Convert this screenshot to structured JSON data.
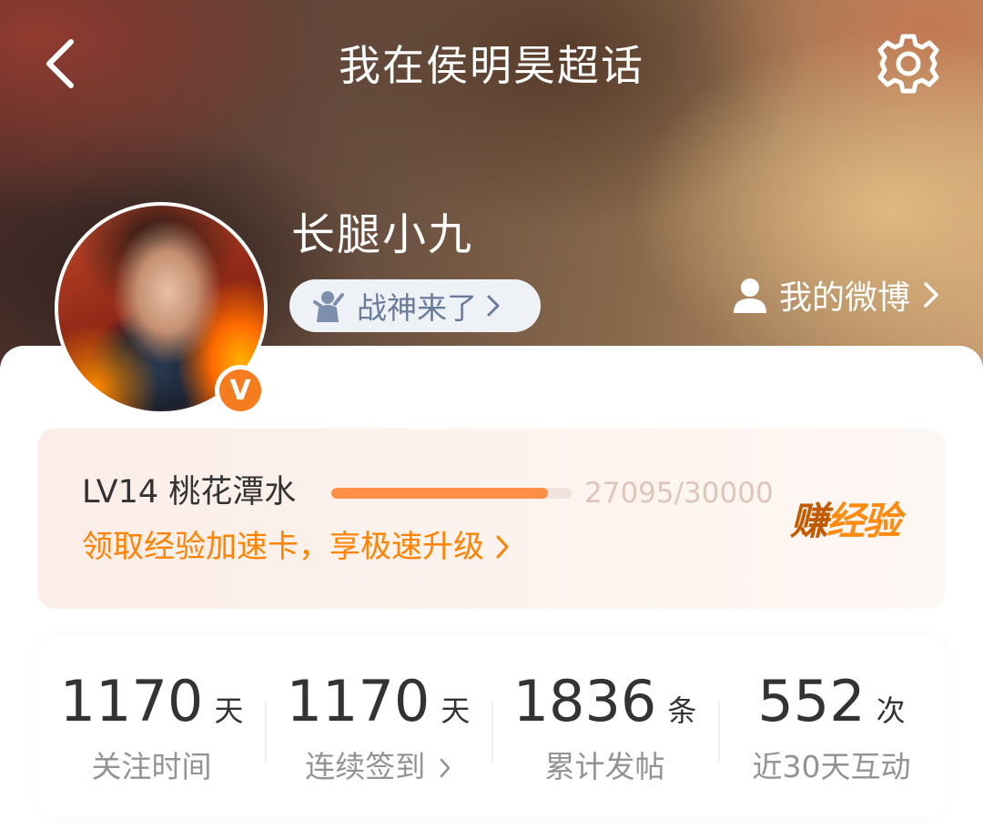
{
  "header": {
    "title": "我在侯明昊超话"
  },
  "profile": {
    "username": "长腿小九",
    "badge_label": "战神来了",
    "my_weibo_label": "我的微博",
    "verified_mark": "V"
  },
  "level": {
    "name": "LV14 桃花潭水",
    "progress_text": "27095/30000",
    "progress_fraction": 0.903,
    "promo_text": "领取经验加速卡，享极速升级",
    "earn_part1": "赚",
    "earn_part2": "经验"
  },
  "stats": [
    {
      "value": "1170",
      "unit": "天",
      "label": "关注时间"
    },
    {
      "value": "1170",
      "unit": "天",
      "label": "连续签到"
    },
    {
      "value": "1836",
      "unit": "条",
      "label": "累计发帖"
    },
    {
      "value": "552",
      "unit": "次",
      "label": "近30天互动"
    }
  ],
  "colors": {
    "accent_orange": "#ff8200",
    "progress": "#ff8f45",
    "verified": "#f57c1f"
  },
  "icons": {
    "back": "back-arrow-icon",
    "settings": "gear-icon",
    "badge": "mascot-icon",
    "user": "user-icon",
    "chevron": "chevron-right-icon"
  }
}
